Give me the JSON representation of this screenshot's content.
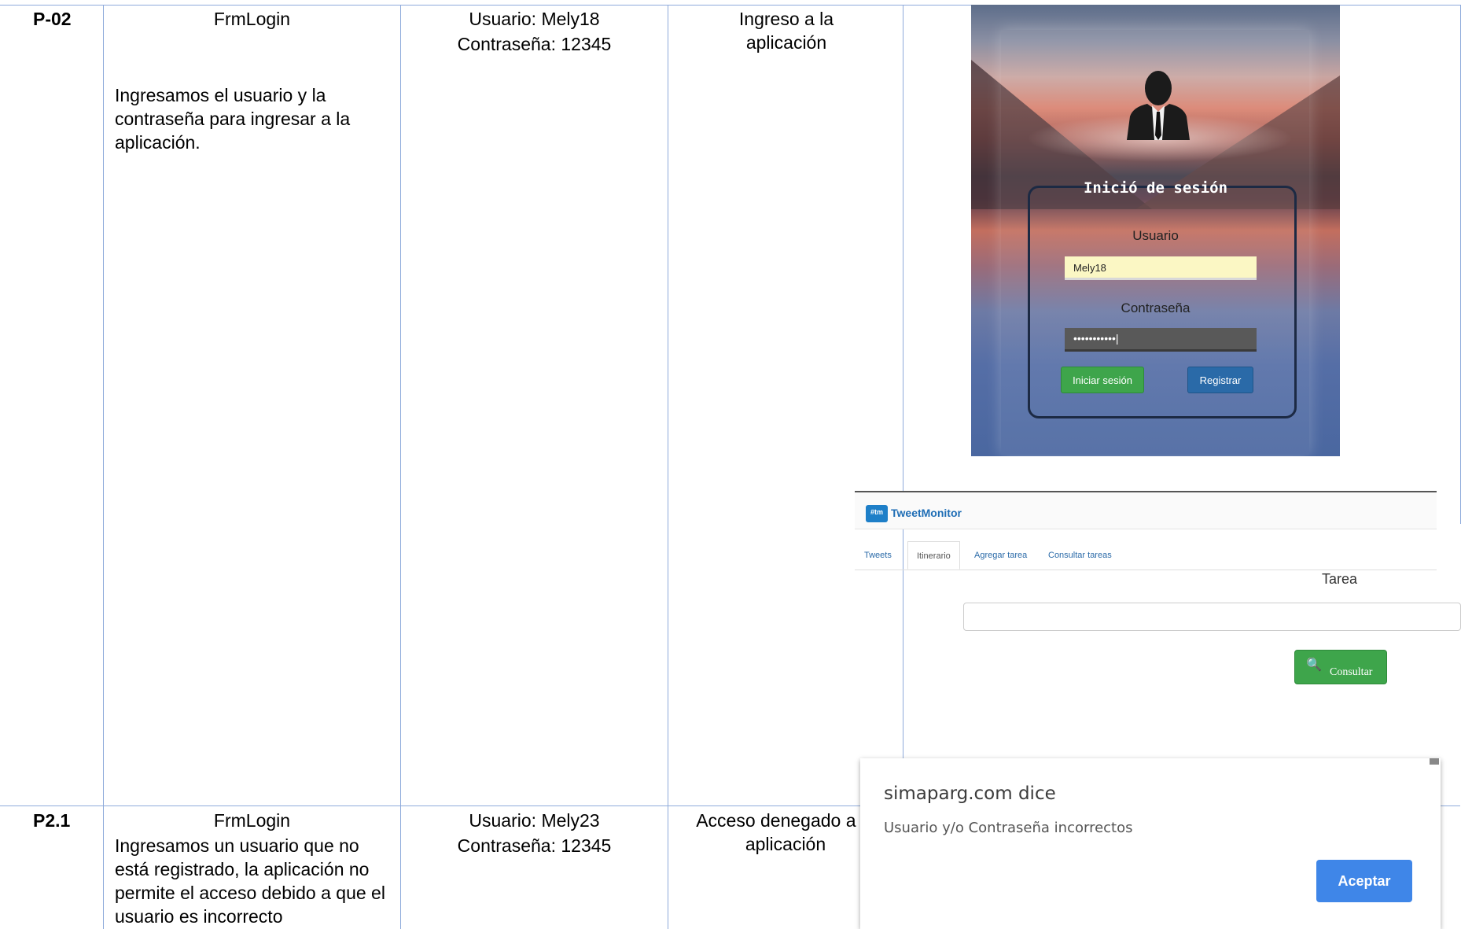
{
  "rows": [
    {
      "id": "P-02",
      "form": "FrmLogin",
      "description": "Ingresamos el usuario y la contraseña para ingresar a la aplicación.",
      "input_user": "Usuario: Mely18",
      "input_pass": "Contraseña: 12345",
      "expected": "Ingreso a la aplicación"
    },
    {
      "id": "P2.1",
      "form": "FrmLogin",
      "description": "Ingresamos un usuario que no está registrado, la aplicación no permite el acceso debido a que el usuario es incorrecto",
      "input_user": "Usuario: Mely23",
      "input_pass": "Contraseña: 12345",
      "expected": "Acceso denegado a la aplicación"
    }
  ],
  "login_screen": {
    "title": "Inició de sesión",
    "user_label": "Usuario",
    "user_value": "Mely18",
    "pass_label": "Contraseña",
    "pass_value": "•••••••••••|",
    "login_button": "Iniciar sesión",
    "register_button": "Registrar"
  },
  "tweetmonitor_screen": {
    "logo_text": "#tm",
    "brand": "TweetMonitor",
    "tabs": [
      "Tweets",
      "Itinerario",
      "Agregar tarea",
      "Consultar tareas"
    ],
    "active_tab": "Itinerario",
    "field_label": "Tarea",
    "search_icon": "🔍",
    "consult_button": "Consultar"
  },
  "alert_dialog": {
    "title": "simaparg.com dice",
    "message": "Usuario y/o Contraseña incorrectos",
    "ok_button": "Aceptar"
  }
}
